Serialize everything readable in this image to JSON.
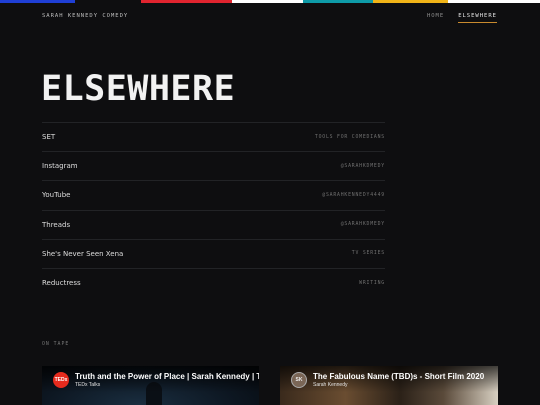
{
  "stripe_colors": [
    "#1f3fd6",
    "#0e0e10",
    "#e0242f",
    "#ffffff",
    "#0e9ba8",
    "#f0b418",
    "#ffffff"
  ],
  "site": {
    "name": "SARAH KENNEDY COMEDY"
  },
  "nav": {
    "items": [
      {
        "label": "HOME"
      },
      {
        "label": "ELSEWHERE"
      }
    ],
    "active": "ELSEWHERE"
  },
  "hero": {
    "title": "ELSEWHERE"
  },
  "links": [
    {
      "label": "SET",
      "meta": "TOOLS FOR COMEDIANS"
    },
    {
      "label": "Instagram",
      "meta": "@SARAHKDMEDY"
    },
    {
      "label": "YouTube",
      "meta": "@SARAHKENNEDY4449"
    },
    {
      "label": "Threads",
      "meta": "@SARAHKDMEDY"
    },
    {
      "label": "She's Never Seen Xena",
      "meta": "TV SERIES"
    },
    {
      "label": "Reductress",
      "meta": "WRITING"
    }
  ],
  "on_tape": {
    "label": "ON TAPE"
  },
  "videos": [
    {
      "title": "Truth and the Power of Place | Sarah Kennedy | TE",
      "channel": "TEDx Talks",
      "logo": "TEDx"
    },
    {
      "title": "The Fabulous Name (TBD)s - Short Film 2020",
      "channel": "Sarah Kennedy",
      "logo": "SK"
    }
  ],
  "colors": {
    "accent": "#c98a2e",
    "background": "#0e0e10"
  }
}
